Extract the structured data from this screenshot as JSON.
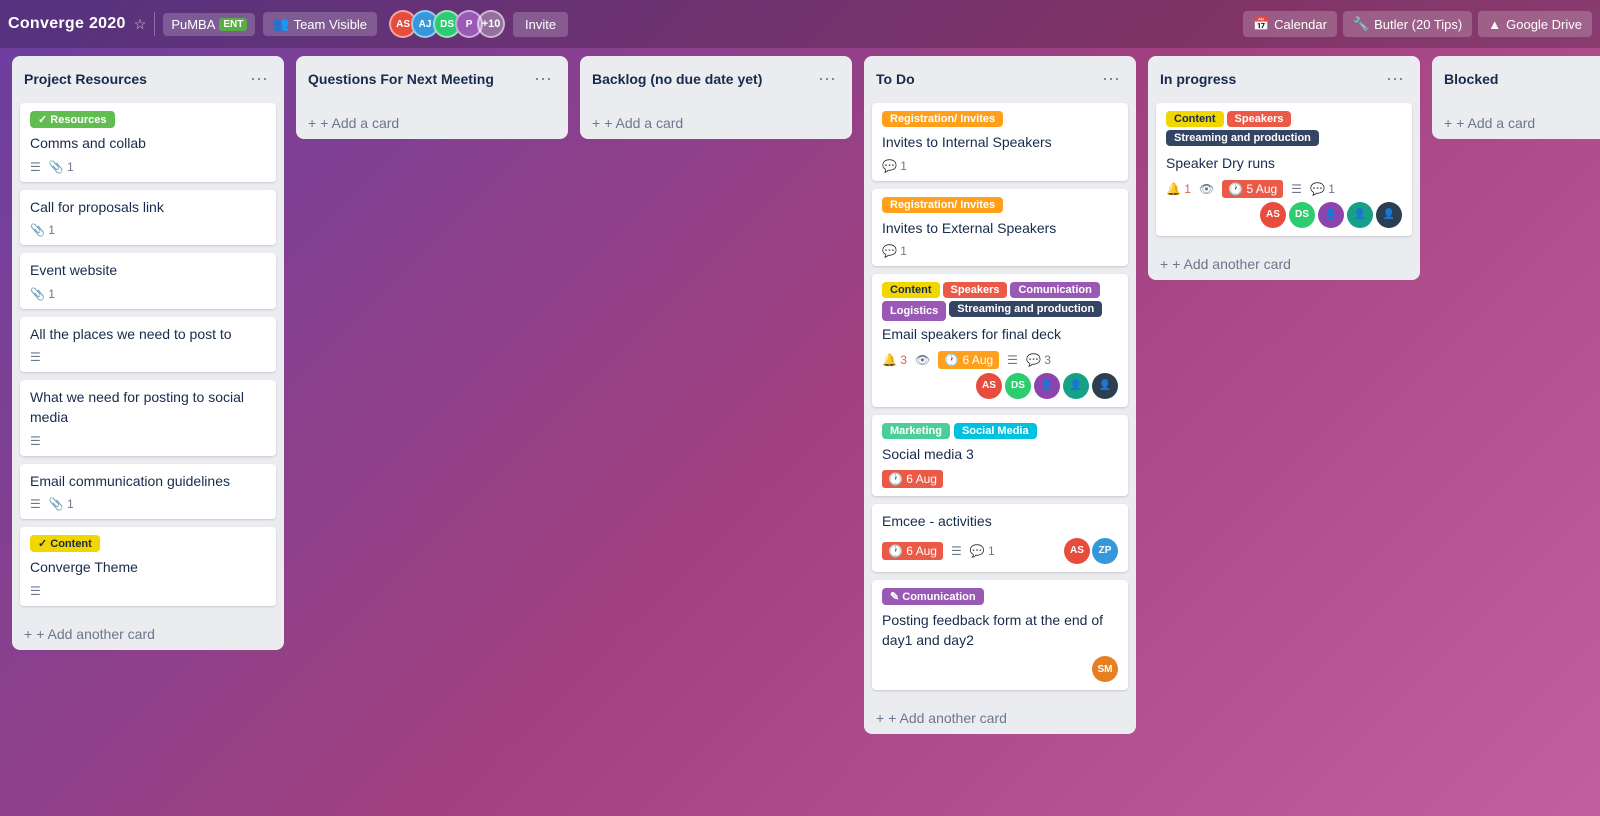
{
  "header": {
    "title": "Converge 2020",
    "pumba": {
      "label": "PuMBA",
      "badge": "ENT"
    },
    "team_visible": "Team Visible",
    "avatars": [
      {
        "initials": "AS",
        "color": "#e74c3c"
      },
      {
        "initials": "AJ",
        "color": "#3498db"
      },
      {
        "initials": "DS",
        "color": "#2ecc71"
      },
      {
        "initials": "P",
        "color": "#9b59b6"
      }
    ],
    "plus_more": "+10",
    "invite": "Invite",
    "actions": [
      {
        "label": "Calendar",
        "icon": "📅"
      },
      {
        "label": "Butler (20 Tips)",
        "icon": "🔧"
      },
      {
        "label": "Google Drive",
        "icon": "▲"
      }
    ]
  },
  "lists": [
    {
      "id": "project-resources",
      "title": "Project Resources",
      "cards": [
        {
          "labels": [
            {
              "text": "✓ Resources",
              "class": "label-green"
            }
          ],
          "title": "Comms and collab",
          "meta": [
            {
              "type": "checklist",
              "icon": "☰"
            },
            {
              "type": "attachment",
              "icon": "📎",
              "count": "1"
            }
          ]
        },
        {
          "labels": [],
          "title": "Call for proposals link",
          "meta": [
            {
              "type": "attachment",
              "icon": "📎",
              "count": "1"
            }
          ]
        },
        {
          "labels": [],
          "title": "Event website",
          "meta": [
            {
              "type": "attachment",
              "icon": "📎",
              "count": "1"
            }
          ]
        },
        {
          "labels": [],
          "title": "All the places we need to post to",
          "meta": [
            {
              "type": "checklist",
              "icon": "☰"
            }
          ]
        },
        {
          "labels": [],
          "title": "What we need for posting to social media",
          "meta": [
            {
              "type": "checklist",
              "icon": "☰"
            }
          ]
        },
        {
          "labels": [],
          "title": "Email communication guidelines",
          "meta": [
            {
              "type": "checklist",
              "icon": "☰"
            },
            {
              "type": "attachment",
              "icon": "📎",
              "count": "1"
            }
          ]
        },
        {
          "labels": [
            {
              "text": "✓ Content",
              "class": "label-yellow"
            }
          ],
          "title": "Converge Theme",
          "meta": [
            {
              "type": "checklist",
              "icon": "☰"
            }
          ]
        }
      ],
      "add_label": "+ Add another card"
    },
    {
      "id": "questions-next-meeting",
      "title": "Questions For Next Meeting",
      "cards": [],
      "add_label": "+ Add a card"
    },
    {
      "id": "backlog",
      "title": "Backlog (no due date yet)",
      "cards": [],
      "add_label": "+ Add a card"
    },
    {
      "id": "to-do",
      "title": "To Do",
      "cards": [
        {
          "labels": [
            {
              "text": "Registration/ Invites",
              "class": "label-orange"
            }
          ],
          "title": "Invites to Internal Speakers",
          "meta": [
            {
              "type": "comment",
              "icon": "💬",
              "count": "1"
            }
          ]
        },
        {
          "labels": [
            {
              "text": "Registration/ Invites",
              "class": "label-orange"
            }
          ],
          "title": "Invites to External Speakers",
          "meta": [
            {
              "type": "comment",
              "icon": "💬",
              "count": "1"
            }
          ]
        },
        {
          "labels": [
            {
              "text": "Content",
              "class": "label-yellow"
            },
            {
              "text": "Speakers",
              "class": "label-red"
            },
            {
              "text": "Comunication",
              "class": "label-purple"
            },
            {
              "text": "Logistics",
              "class": "label-purple"
            },
            {
              "text": "streaming",
              "class": "streaming"
            }
          ],
          "title": "Email speakers for final deck",
          "meta": [
            {
              "type": "alert",
              "icon": "🔔",
              "count": "3"
            },
            {
              "type": "eye",
              "icon": "👁"
            },
            {
              "type": "due",
              "text": "6 Aug",
              "class": "warning"
            },
            {
              "type": "checklist",
              "icon": "☰"
            },
            {
              "type": "comment",
              "icon": "💬",
              "count": "3"
            }
          ],
          "avatars": [
            "AS",
            "DS",
            "👤",
            "👤",
            "👤"
          ]
        },
        {
          "labels": [
            {
              "text": "Marketing",
              "class": "label-mint"
            },
            {
              "text": "Social Media",
              "class": "label-teal"
            }
          ],
          "title": "Social media 3",
          "meta": [
            {
              "type": "due",
              "text": "6 Aug",
              "class": "overdue"
            }
          ]
        },
        {
          "labels": [],
          "title": "Emcee - activities",
          "meta": [
            {
              "type": "due",
              "text": "6 Aug",
              "class": "overdue"
            },
            {
              "type": "checklist",
              "icon": "☰"
            },
            {
              "type": "comment",
              "icon": "💬",
              "count": "1"
            }
          ],
          "avatars": [
            "AS",
            "ZP"
          ]
        },
        {
          "labels": [
            {
              "text": "✎ Comunication",
              "class": "label-purple"
            }
          ],
          "title": "Posting feedback form at the end of day1 and day2",
          "meta": [],
          "avatars": [
            "SM"
          ]
        }
      ],
      "add_label": "+ Add another card"
    },
    {
      "id": "in-progress",
      "title": "In progress",
      "cards": [
        {
          "labels": [
            {
              "text": "Content",
              "class": "label-yellow"
            },
            {
              "text": "Speakers",
              "class": "label-red"
            },
            {
              "text": "streaming",
              "class": "streaming"
            }
          ],
          "title": "Speaker Dry runs",
          "meta": [
            {
              "type": "alert",
              "icon": "🔔",
              "count": "1"
            },
            {
              "type": "eye",
              "icon": "👁"
            },
            {
              "type": "due",
              "text": "5 Aug",
              "class": "overdue"
            },
            {
              "type": "checklist",
              "icon": "☰"
            },
            {
              "type": "comment",
              "icon": "💬",
              "count": "1"
            }
          ],
          "avatars": [
            "AS",
            "DS",
            "👤",
            "👤",
            "👤"
          ]
        }
      ],
      "add_label": "+ Add another card"
    },
    {
      "id": "blocked",
      "title": "Blocked",
      "cards": [],
      "add_label": "+ Add a card"
    }
  ]
}
